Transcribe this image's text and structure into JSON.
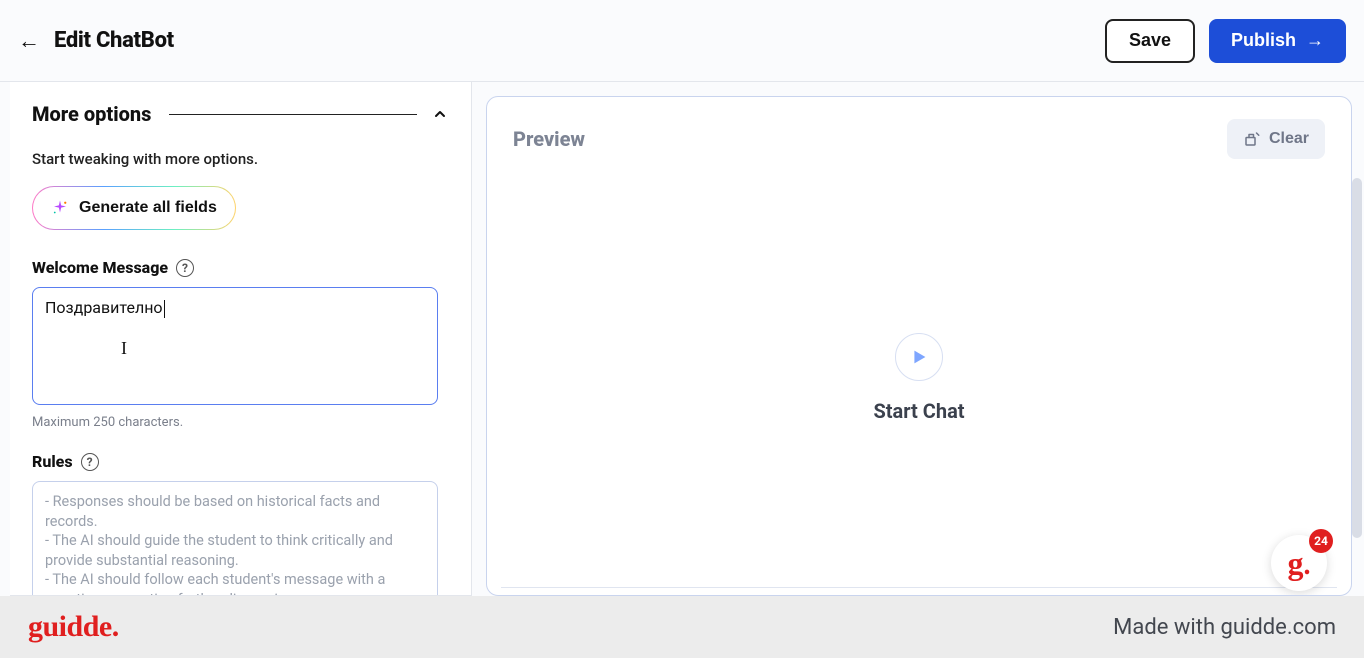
{
  "header": {
    "title": "Edit ChatBot",
    "save_label": "Save",
    "publish_label": "Publish"
  },
  "left": {
    "section_title": "More options",
    "section_sub": "Start tweaking with more options.",
    "generate_label": "Generate all fields",
    "welcome_label": "Welcome Message",
    "welcome_value": "Поздравително",
    "char_hint": "Maximum 250 characters.",
    "rules_label": "Rules",
    "rules_placeholder": "- Responses should be based on historical facts and records.\n- The AI should guide the student to think critically and provide substantial reasoning.\n- The AI should follow each student's message with a question, prompting further discussion.\n- The conversation should be conducted in French."
  },
  "preview": {
    "title": "Preview",
    "clear_label": "Clear",
    "start_label": "Start Chat"
  },
  "widget": {
    "badge_count": "24"
  },
  "footer": {
    "logo": "guidde.",
    "made_with": "Made with guidde.com"
  }
}
